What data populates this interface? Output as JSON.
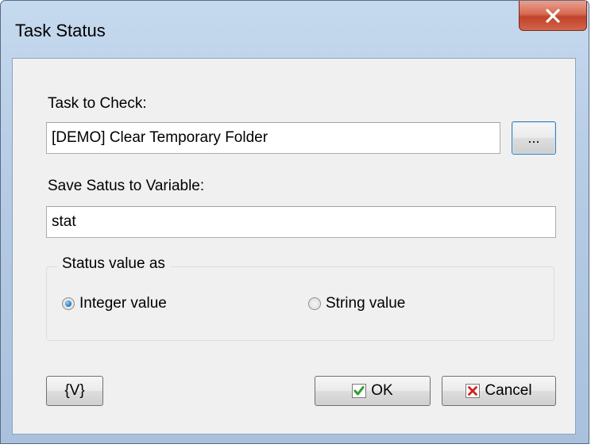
{
  "window": {
    "title": "Task Status",
    "close_glyph": "x"
  },
  "task_to_check": {
    "label": "Task to Check:",
    "value": "[DEMO] Clear Temporary Folder",
    "browse_label": "..."
  },
  "save_status": {
    "label": "Save Satus to Variable:",
    "value": "stat"
  },
  "status_group": {
    "legend": "Status value as",
    "options": [
      {
        "label": "Integer value",
        "selected": true
      },
      {
        "label": "String value",
        "selected": false
      }
    ]
  },
  "footer": {
    "variables_label": "{V}",
    "ok_label": "OK",
    "cancel_label": "Cancel"
  },
  "colors": {
    "ok_check": "#2e9e2e",
    "cancel_x": "#d62020",
    "close_button": "#c1432a"
  }
}
